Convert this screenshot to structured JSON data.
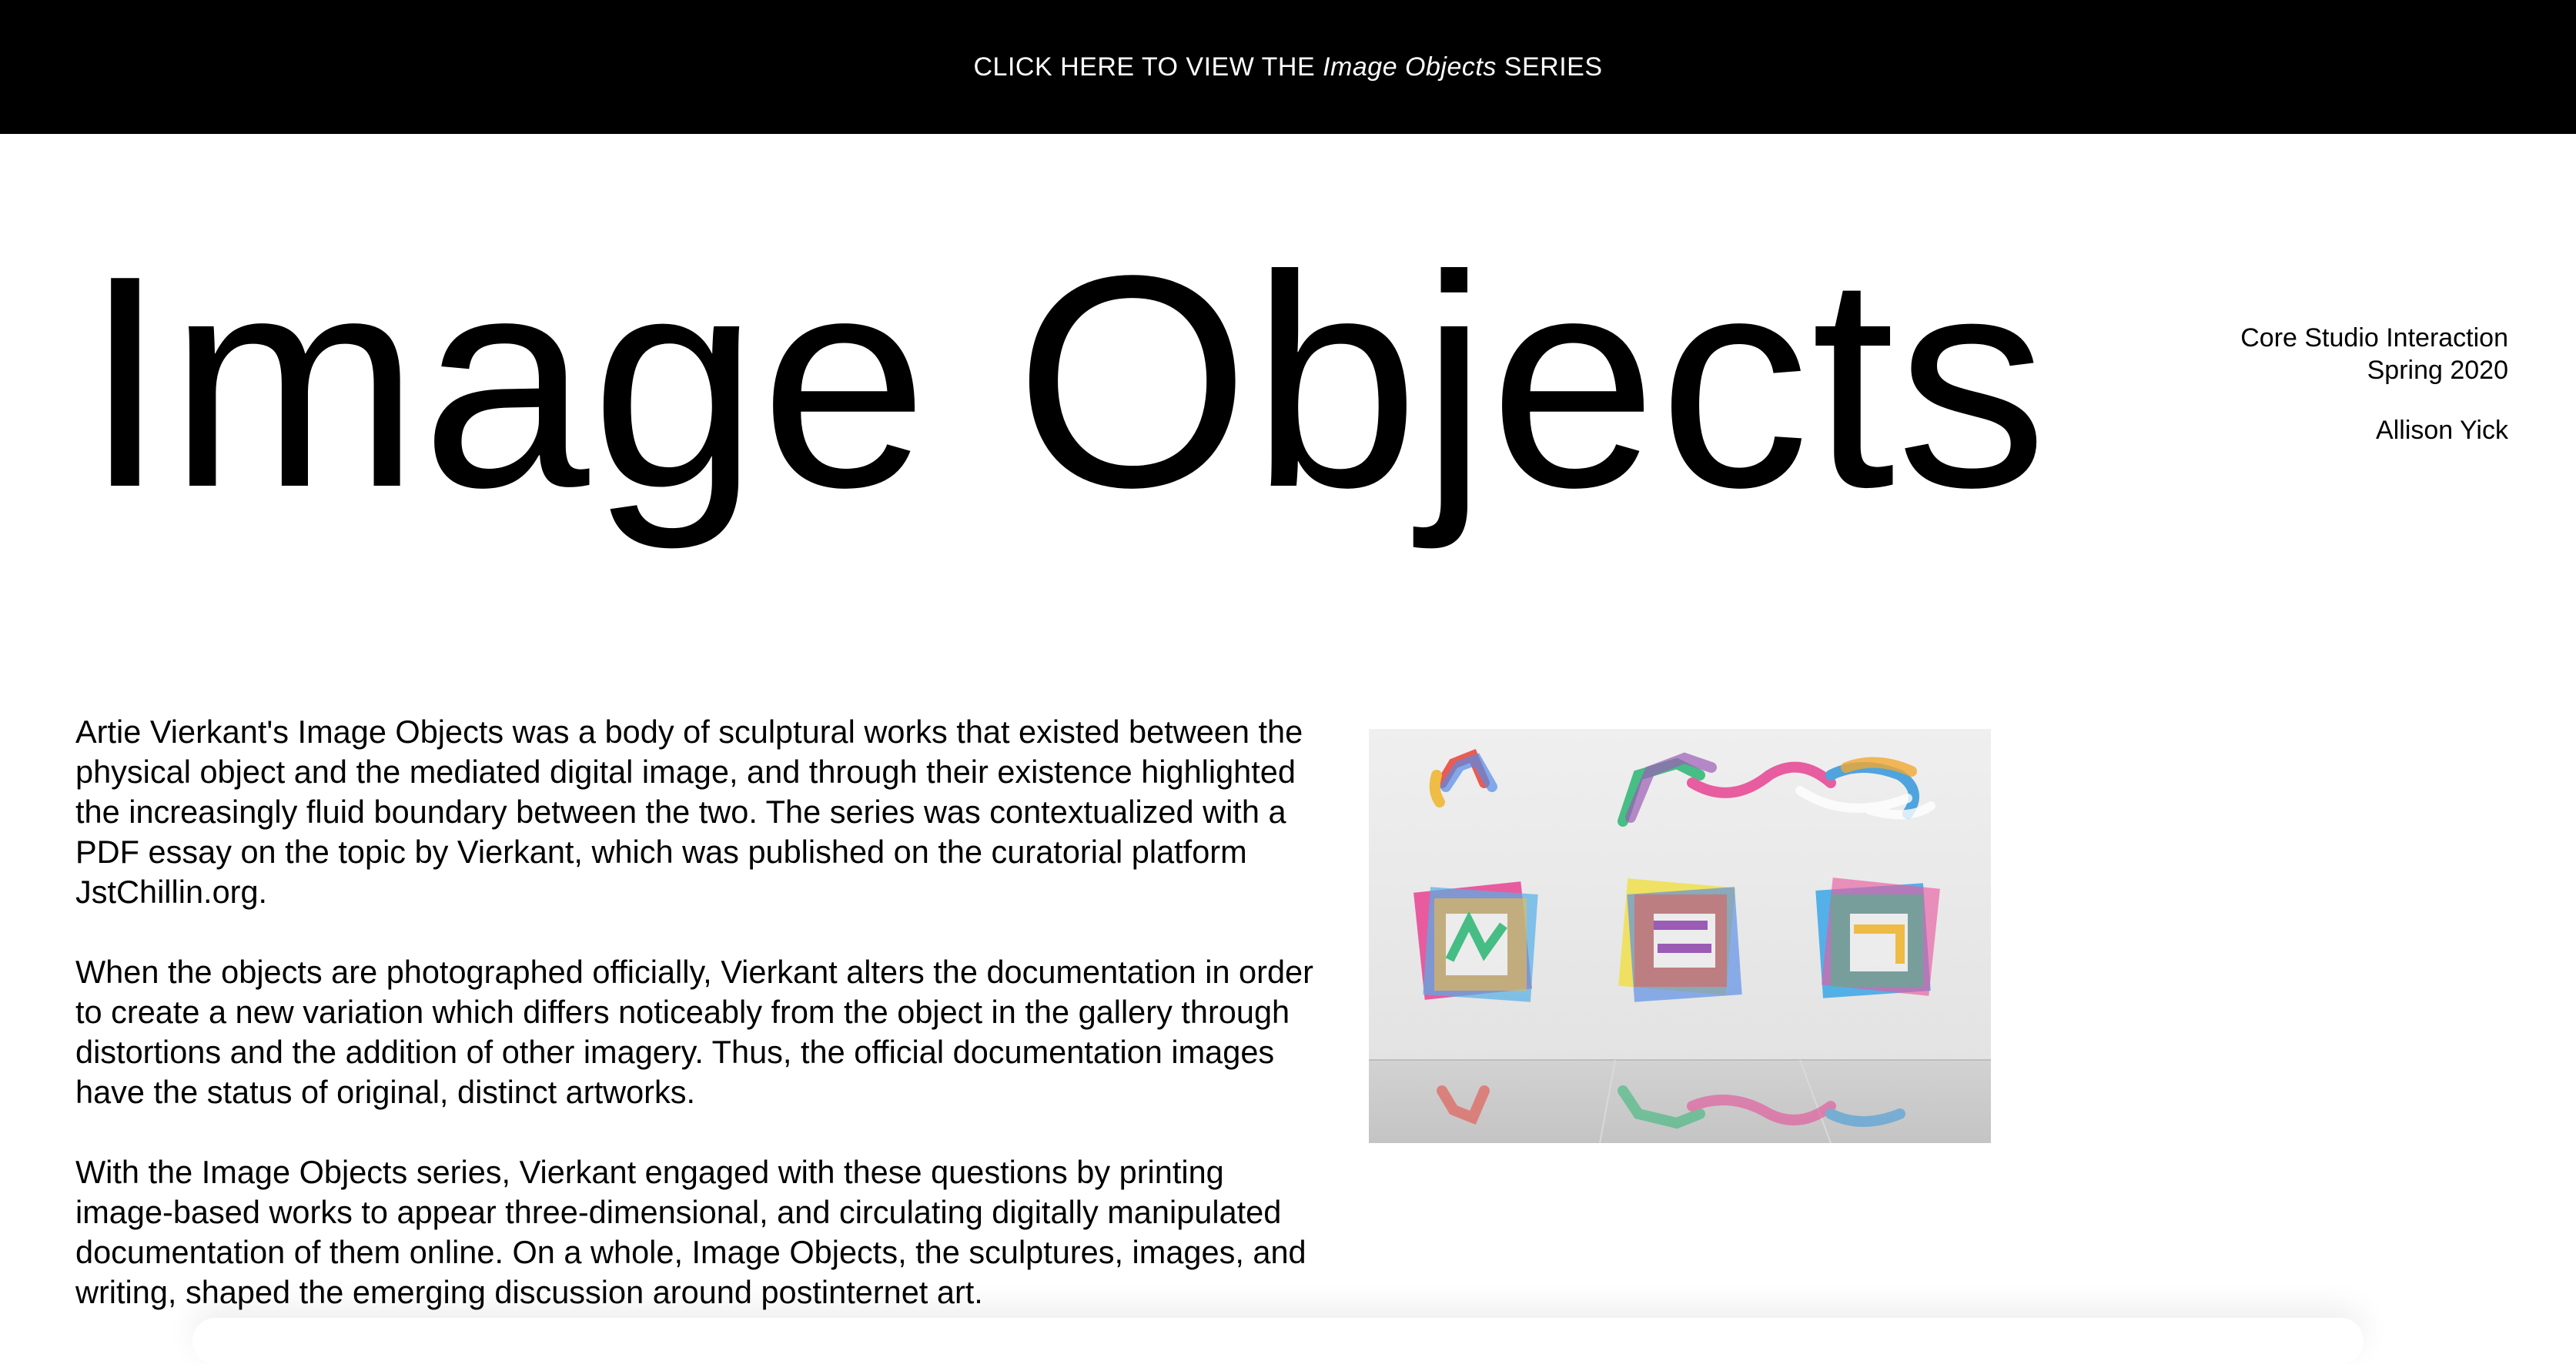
{
  "banner": {
    "prefix": "CLICK HERE TO VIEW THE",
    "italic": "Image Objects",
    "suffix": "SERIES"
  },
  "title": "Image Objects",
  "meta": {
    "course": "Core Studio Interaction",
    "term": "Spring 2020",
    "author": "Allison Yick"
  },
  "paragraphs": [
    "Artie Vierkant's Image Objects was a body of sculptural works that existed between the physical object and the mediated digital image, and through their existence highlighted the increasingly fluid boundary between the two. The series was contextualized with a PDF essay on the topic by Vierkant, which was published on the curatorial platform JstChillin.org.",
    "When the objects are photographed officially, Vierkant alters the documentation in order to create a new variation which differs noticeably from the object in the gallery through distortions and the addition of other imagery. Thus, the official documentation images have the status of original, distinct artworks.",
    "With the Image Objects series, Vierkant engaged with these questions by printing image-based works to appear three-dimensional, and circulating digitally manipulated documentation of them online. On a whole, Image Objects, the sculptures, images, and writing, shaped the emerging discussion around postinternet art."
  ]
}
